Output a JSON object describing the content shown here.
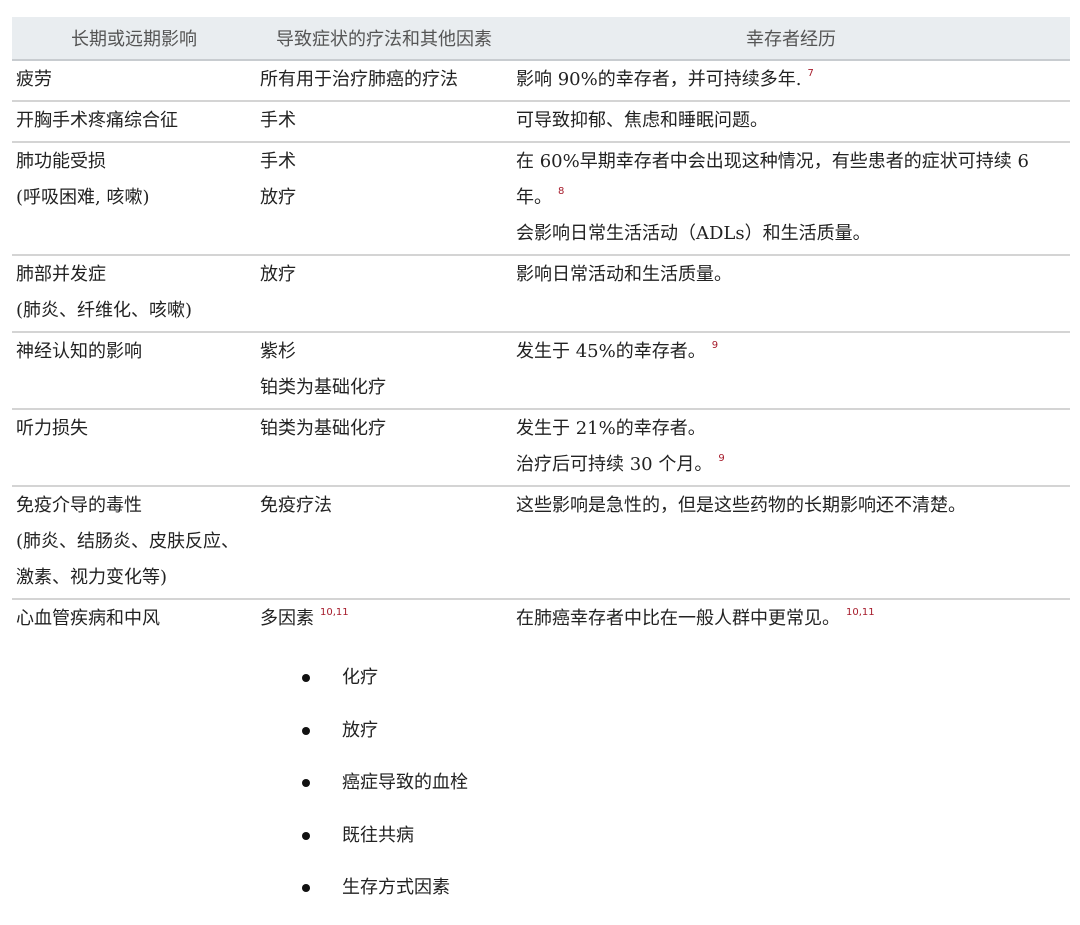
{
  "table": {
    "headers": [
      "长期或远期影响",
      "导致症状的疗法和其他因素",
      "幸存者经历"
    ],
    "rows": [
      {
        "effect": [
          "疲劳"
        ],
        "causes": [
          "所有用于治疗肺癌的疗法"
        ],
        "experience": [
          {
            "text": "影响 90%的幸存者，并可持续多年.",
            "ref": "7"
          }
        ]
      },
      {
        "effect": [
          "开胸手术疼痛综合征"
        ],
        "causes": [
          "手术"
        ],
        "experience": [
          {
            "text": "可导致抑郁、焦虑和睡眠问题。",
            "ref": ""
          }
        ]
      },
      {
        "effect": [
          "肺功能受损",
          "(呼吸困难, 咳嗽)"
        ],
        "causes": [
          "手术",
          "放疗"
        ],
        "experience": [
          {
            "text": "在 60%早期幸存者中会出现这种情况，有些患者的症状可持续 6 年。",
            "ref": "8"
          },
          {
            "text": "会影响日常生活活动（ADLs）和生活质量。",
            "ref": ""
          }
        ]
      },
      {
        "effect": [
          "肺部并发症",
          "(肺炎、纤维化、咳嗽)"
        ],
        "causes": [
          "放疗"
        ],
        "experience": [
          {
            "text": "影响日常活动和生活质量。",
            "ref": ""
          }
        ]
      },
      {
        "effect": [
          "神经认知的影响"
        ],
        "causes": [
          "紫杉",
          "铂类为基础化疗"
        ],
        "experience": [
          {
            "text": "发生于 45%的幸存者。",
            "ref": "9"
          }
        ]
      },
      {
        "effect": [
          "听力损失"
        ],
        "causes": [
          "铂类为基础化疗"
        ],
        "experience": [
          {
            "text": "发生于 21%的幸存者。",
            "ref": ""
          },
          {
            "text": "治疗后可持续 30 个月。",
            "ref": "9"
          }
        ]
      },
      {
        "effect": [
          "免疫介导的毒性",
          "(肺炎、结肠炎、皮肤反应、",
          "激素、视力变化等)"
        ],
        "causes": [
          "免疫疗法"
        ],
        "experience": [
          {
            "text": "这些影响是急性的，但是这些药物的长期影响还不清楚。",
            "ref": ""
          }
        ]
      },
      {
        "effect": [
          "心血管疾病和中风"
        ],
        "causes": [
          "多因素"
        ],
        "causes_ref": "10,11",
        "experience": [
          {
            "text": "在肺癌幸存者中比在一般人群中更常见。",
            "ref": "10,11"
          }
        ]
      }
    ]
  },
  "factors": [
    "化疗",
    "放疗",
    "癌症导致的血栓",
    "既往共病",
    "生存方式因素"
  ],
  "colors": {
    "header_bg": "#e9edf0",
    "ref_color": "#a61b2b",
    "row_divider": "#d4d4d4"
  }
}
